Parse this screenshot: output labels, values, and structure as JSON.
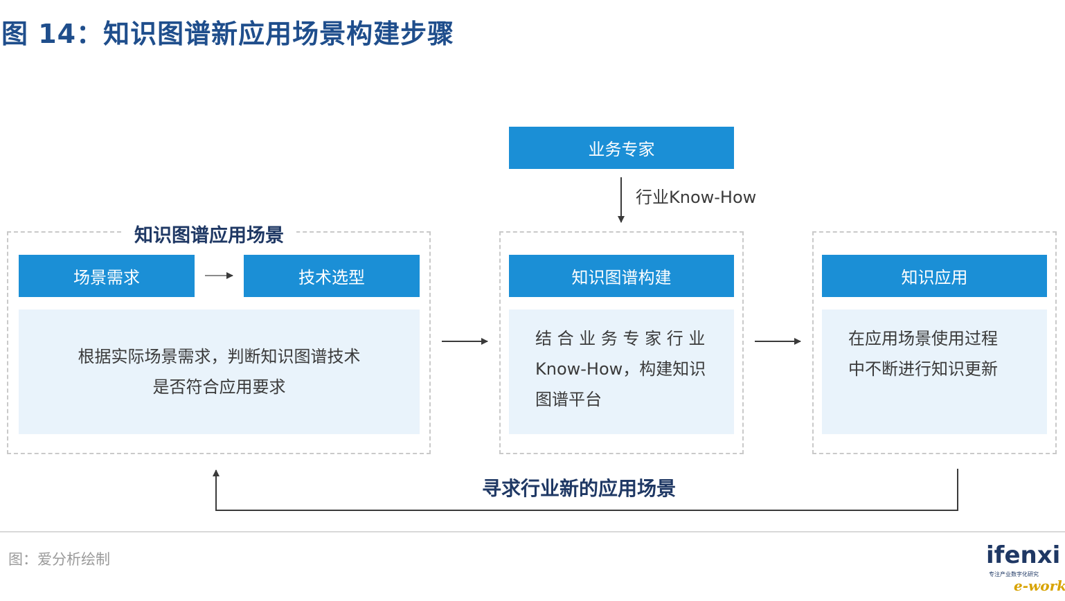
{
  "title": "图 14：知识图谱新应用场景构建步骤",
  "expert_box": "业务专家",
  "expert_arrow_label": "行业Know-How",
  "left_group": {
    "label": "知识图谱应用场景",
    "step1": "场景需求",
    "step2": "技术选型",
    "desc_lines": [
      "根据实际场景需求，判断知识图谱技术",
      "是否符合应用要求"
    ]
  },
  "middle_group": {
    "header": "知识图谱构建",
    "desc_lines": [
      "结 合 业 务 专 家 行 业",
      "Know-How，构建知识",
      "图谱平台"
    ]
  },
  "right_group": {
    "header": "知识应用",
    "desc_lines": [
      "在应用场景使用过程",
      "中不断进行知识更新"
    ]
  },
  "loop_label": "寻求行业新的应用场景",
  "source": "图：爱分析绘制",
  "logo": {
    "word": "ifenxi",
    "tagline": "专注产业数字化研究",
    "mark": "e-works"
  },
  "colors": {
    "bar_blue": "#1b8fd6",
    "panel_bg": "#e9f3fb",
    "title_navy": "#1f4e8c",
    "label_navy": "#1f3864"
  }
}
